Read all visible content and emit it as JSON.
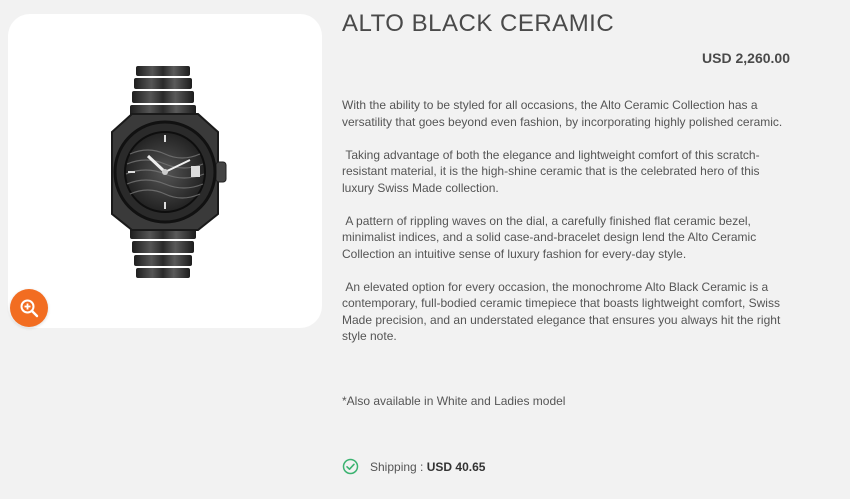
{
  "product": {
    "title": "ALTO BLACK CERAMIC",
    "price": "USD 2,260.00",
    "image_alt": "watch-image",
    "zoom_icon": "zoom-in-icon",
    "description": [
      "With the ability to be styled for all occasions, the Alto Ceramic Collection has a versatility that goes beyond even fashion, by incorporating highly polished ceramic.",
      " Taking advantage of both the elegance and lightweight comfort of this scratch-resistant material, it is the high-shine ceramic that is the celebrated hero of this luxury Swiss Made collection.",
      " A pattern of rippling waves on the dial, a carefully finished flat ceramic bezel, minimalist indices, and a solid case-and-bracelet design lend the Alto Ceramic Collection an intuitive sense of luxury fashion for every-day style.",
      " An elevated option for every occasion, the monochrome Alto Black Ceramic is a contemporary, full-bodied ceramic timepiece that boasts lightweight comfort, Swiss Made precision, and an understated elegance that ensures you always hit the right style note."
    ],
    "availability_note": "*Also available in White and Ladies model",
    "shipping": {
      "label": "Shipping : ",
      "value": "USD 40.65",
      "icon": "check-circle-icon"
    }
  },
  "colors": {
    "accent": "#f26d21",
    "check": "#3cb371",
    "background": "#f2f2f2"
  }
}
